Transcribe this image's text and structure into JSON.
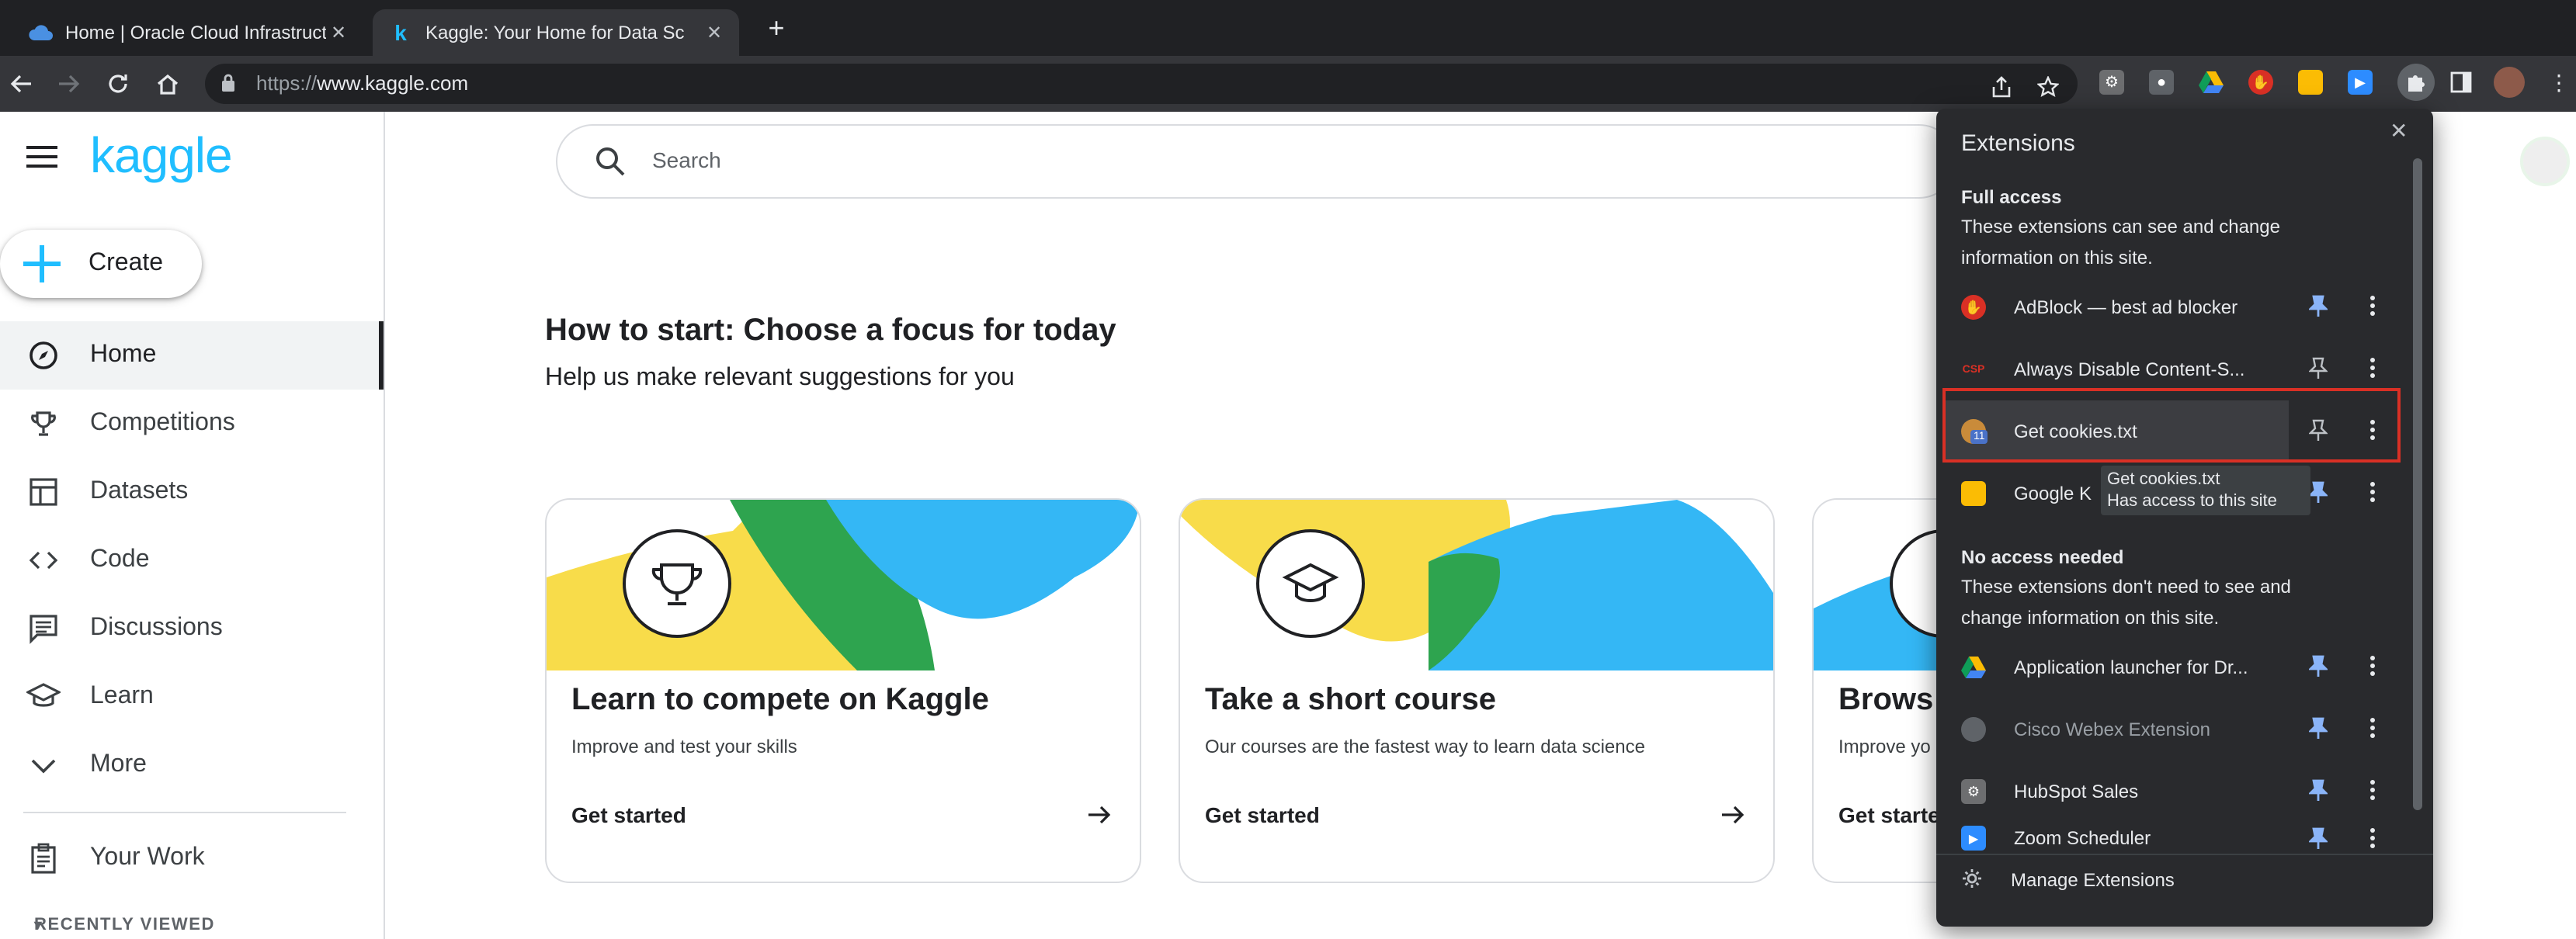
{
  "browser": {
    "tabs": [
      {
        "title": "Home | Oracle Cloud Infrastructu",
        "active": false,
        "favicon": "cloud-icon"
      },
      {
        "title": "Kaggle: Your Home for Data Sc",
        "active": true,
        "favicon": "kaggle-k-icon"
      }
    ],
    "url_scheme": "https://",
    "url_host": "www.kaggle.com"
  },
  "sidebar": {
    "logo": "kaggle",
    "create_label": "Create",
    "items": [
      {
        "label": "Home",
        "icon": "compass-icon",
        "active": true
      },
      {
        "label": "Competitions",
        "icon": "trophy-icon"
      },
      {
        "label": "Datasets",
        "icon": "table-icon"
      },
      {
        "label": "Code",
        "icon": "code-icon"
      },
      {
        "label": "Discussions",
        "icon": "discussion-icon"
      },
      {
        "label": "Learn",
        "icon": "graduation-cap-icon"
      },
      {
        "label": "More",
        "icon": "chevron-down-icon"
      }
    ],
    "your_work": "Your Work",
    "recently_viewed": "RECENTLY VIEWED"
  },
  "search": {
    "placeholder": "Search"
  },
  "main": {
    "heading": "How to start: Choose a focus for today",
    "subheading": "Help us make relevant suggestions for you",
    "cards": [
      {
        "title": "Learn to compete on Kaggle",
        "desc": "Improve and test your skills",
        "cta": "Get started"
      },
      {
        "title": "Take a short course",
        "desc": "Our courses are the fastest way to learn data science",
        "cta": "Get started"
      },
      {
        "title": "Brows",
        "desc": "Improve yo",
        "cta": "Get starte"
      }
    ]
  },
  "extensions_popup": {
    "title": "Extensions",
    "full_access_title": "Full access",
    "full_access_desc": "These extensions can see and change information on this site.",
    "full_access_items": [
      {
        "name": "AdBlock — best ad blocker",
        "icon": "adblock-icon",
        "pinned": true
      },
      {
        "name": "Always Disable Content-S...",
        "icon": "csp-icon",
        "pinned": false
      },
      {
        "name": "Get cookies.txt",
        "icon": "cookie-icon",
        "pinned": false,
        "badge": "11"
      },
      {
        "name": "Google K",
        "icon": "google-keep-icon",
        "pinned": true
      }
    ],
    "tooltip_line1": "Get cookies.txt",
    "tooltip_line2": "Has access to this site",
    "no_access_title": "No access needed",
    "no_access_desc": "These extensions don't need to see and change information on this site.",
    "no_access_items": [
      {
        "name": "Application launcher for Dr...",
        "icon": "google-drive-icon",
        "pinned": true
      },
      {
        "name": "Cisco Webex Extension",
        "icon": "webex-icon",
        "pinned": true
      },
      {
        "name": "HubSpot Sales",
        "icon": "hubspot-icon",
        "pinned": true
      },
      {
        "name": "Zoom Scheduler",
        "icon": "zoom-icon",
        "pinned": true
      }
    ],
    "manage_label": "Manage Extensions"
  },
  "colors": {
    "kaggle_blue": "#20beff",
    "highlight_red": "#d93025",
    "pin_blue": "#8ab4f8"
  }
}
